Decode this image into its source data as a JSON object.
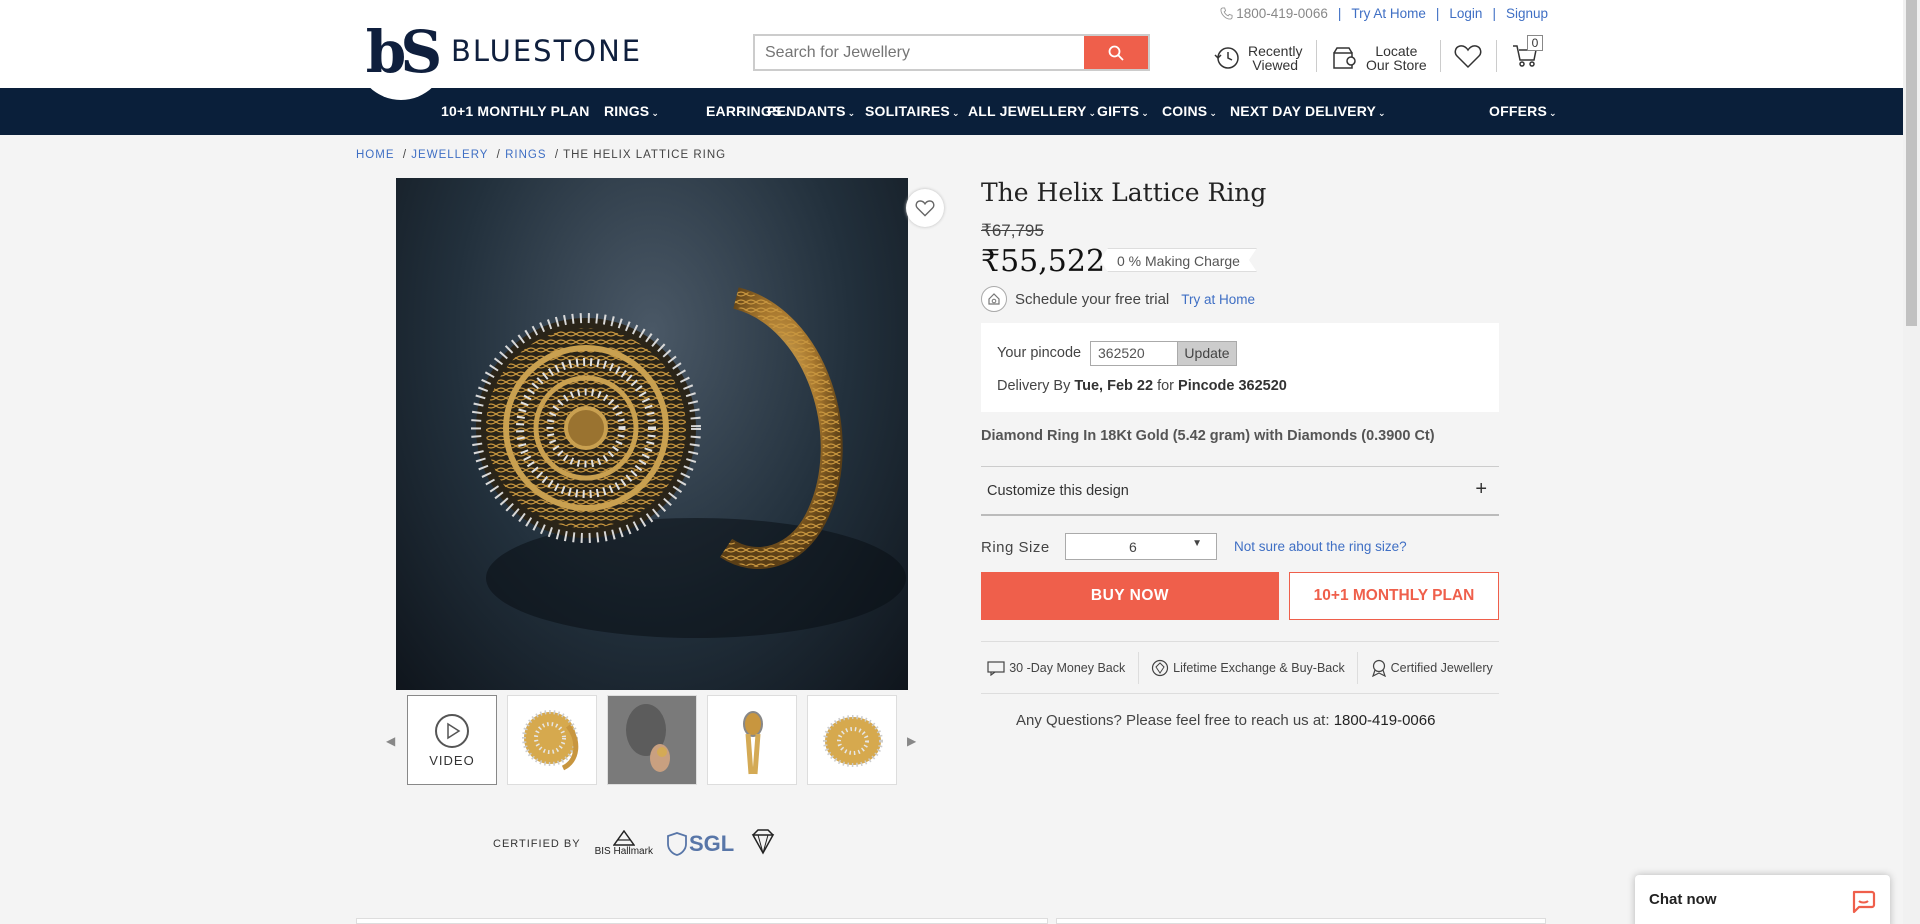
{
  "header": {
    "logo_text": "BLUESTONE",
    "logo_mark": "bS",
    "search_placeholder": "Search for Jewellery",
    "phone": "1800-419-0066",
    "try_at_home": "Try At Home",
    "login": "Login",
    "signup": "Signup",
    "sep": "|",
    "recently_viewed_1": "Recently",
    "recently_viewed_2": "Viewed",
    "locate_1": "Locate",
    "locate_2": "Our Store",
    "cart_count": "0"
  },
  "nav": {
    "items": [
      "10+1 MONTHLY PLAN",
      "RINGS",
      "EARRINGS",
      "PENDANTS",
      "SOLITAIRES",
      "ALL JEWELLERY",
      "GIFTS",
      "COINS",
      "NEXT DAY DELIVERY",
      "OFFERS"
    ]
  },
  "breadcrumb": {
    "home": "HOME",
    "jewellery": "JEWELLERY",
    "rings": "RINGS",
    "current": "THE HELIX LATTICE RING",
    "sep": "/"
  },
  "gallery": {
    "video_label": "VIDEO"
  },
  "certified": {
    "label": "CERTIFIED BY",
    "bis": "BIS Hallmark",
    "sgl": "SGL"
  },
  "product": {
    "title": "The Helix Lattice Ring",
    "old_price": "₹67,795",
    "price": "₹55,522",
    "making_charge": "0 % Making Charge",
    "trial_text": "Schedule your free trial",
    "trial_link": "Try at Home",
    "pincode_label": "Your pincode",
    "pincode_value": "362520",
    "pincode_btn": "Update",
    "delivery_prefix": "Delivery By",
    "delivery_date": "Tue, Feb 22",
    "delivery_for": "for",
    "delivery_pincode": "Pincode 362520",
    "description": "Diamond Ring In 18Kt Gold (5.42 gram) with Diamonds (0.3900 Ct)",
    "customize_label": "Customize this design",
    "customize_plus": "+",
    "ring_size_label": "Ring Size",
    "ring_size_value": "6",
    "ring_size_help": "Not sure about the ring size?",
    "buy_now": "BUY NOW",
    "monthly_plan": "10+1 MONTHLY PLAN",
    "trust_1": "30 -Day Money Back",
    "trust_2": "Lifetime Exchange & Buy-Back",
    "trust_3": "Certified Jewellery",
    "questions_text": "Any Questions? Please feel free to reach us at:",
    "questions_phone": "1800-419-0066"
  },
  "chat": {
    "label": "Chat now"
  },
  "colors": {
    "brand_navy": "#0a1f3a",
    "accent": "#ef5f4b",
    "link": "#3f6fc4"
  }
}
